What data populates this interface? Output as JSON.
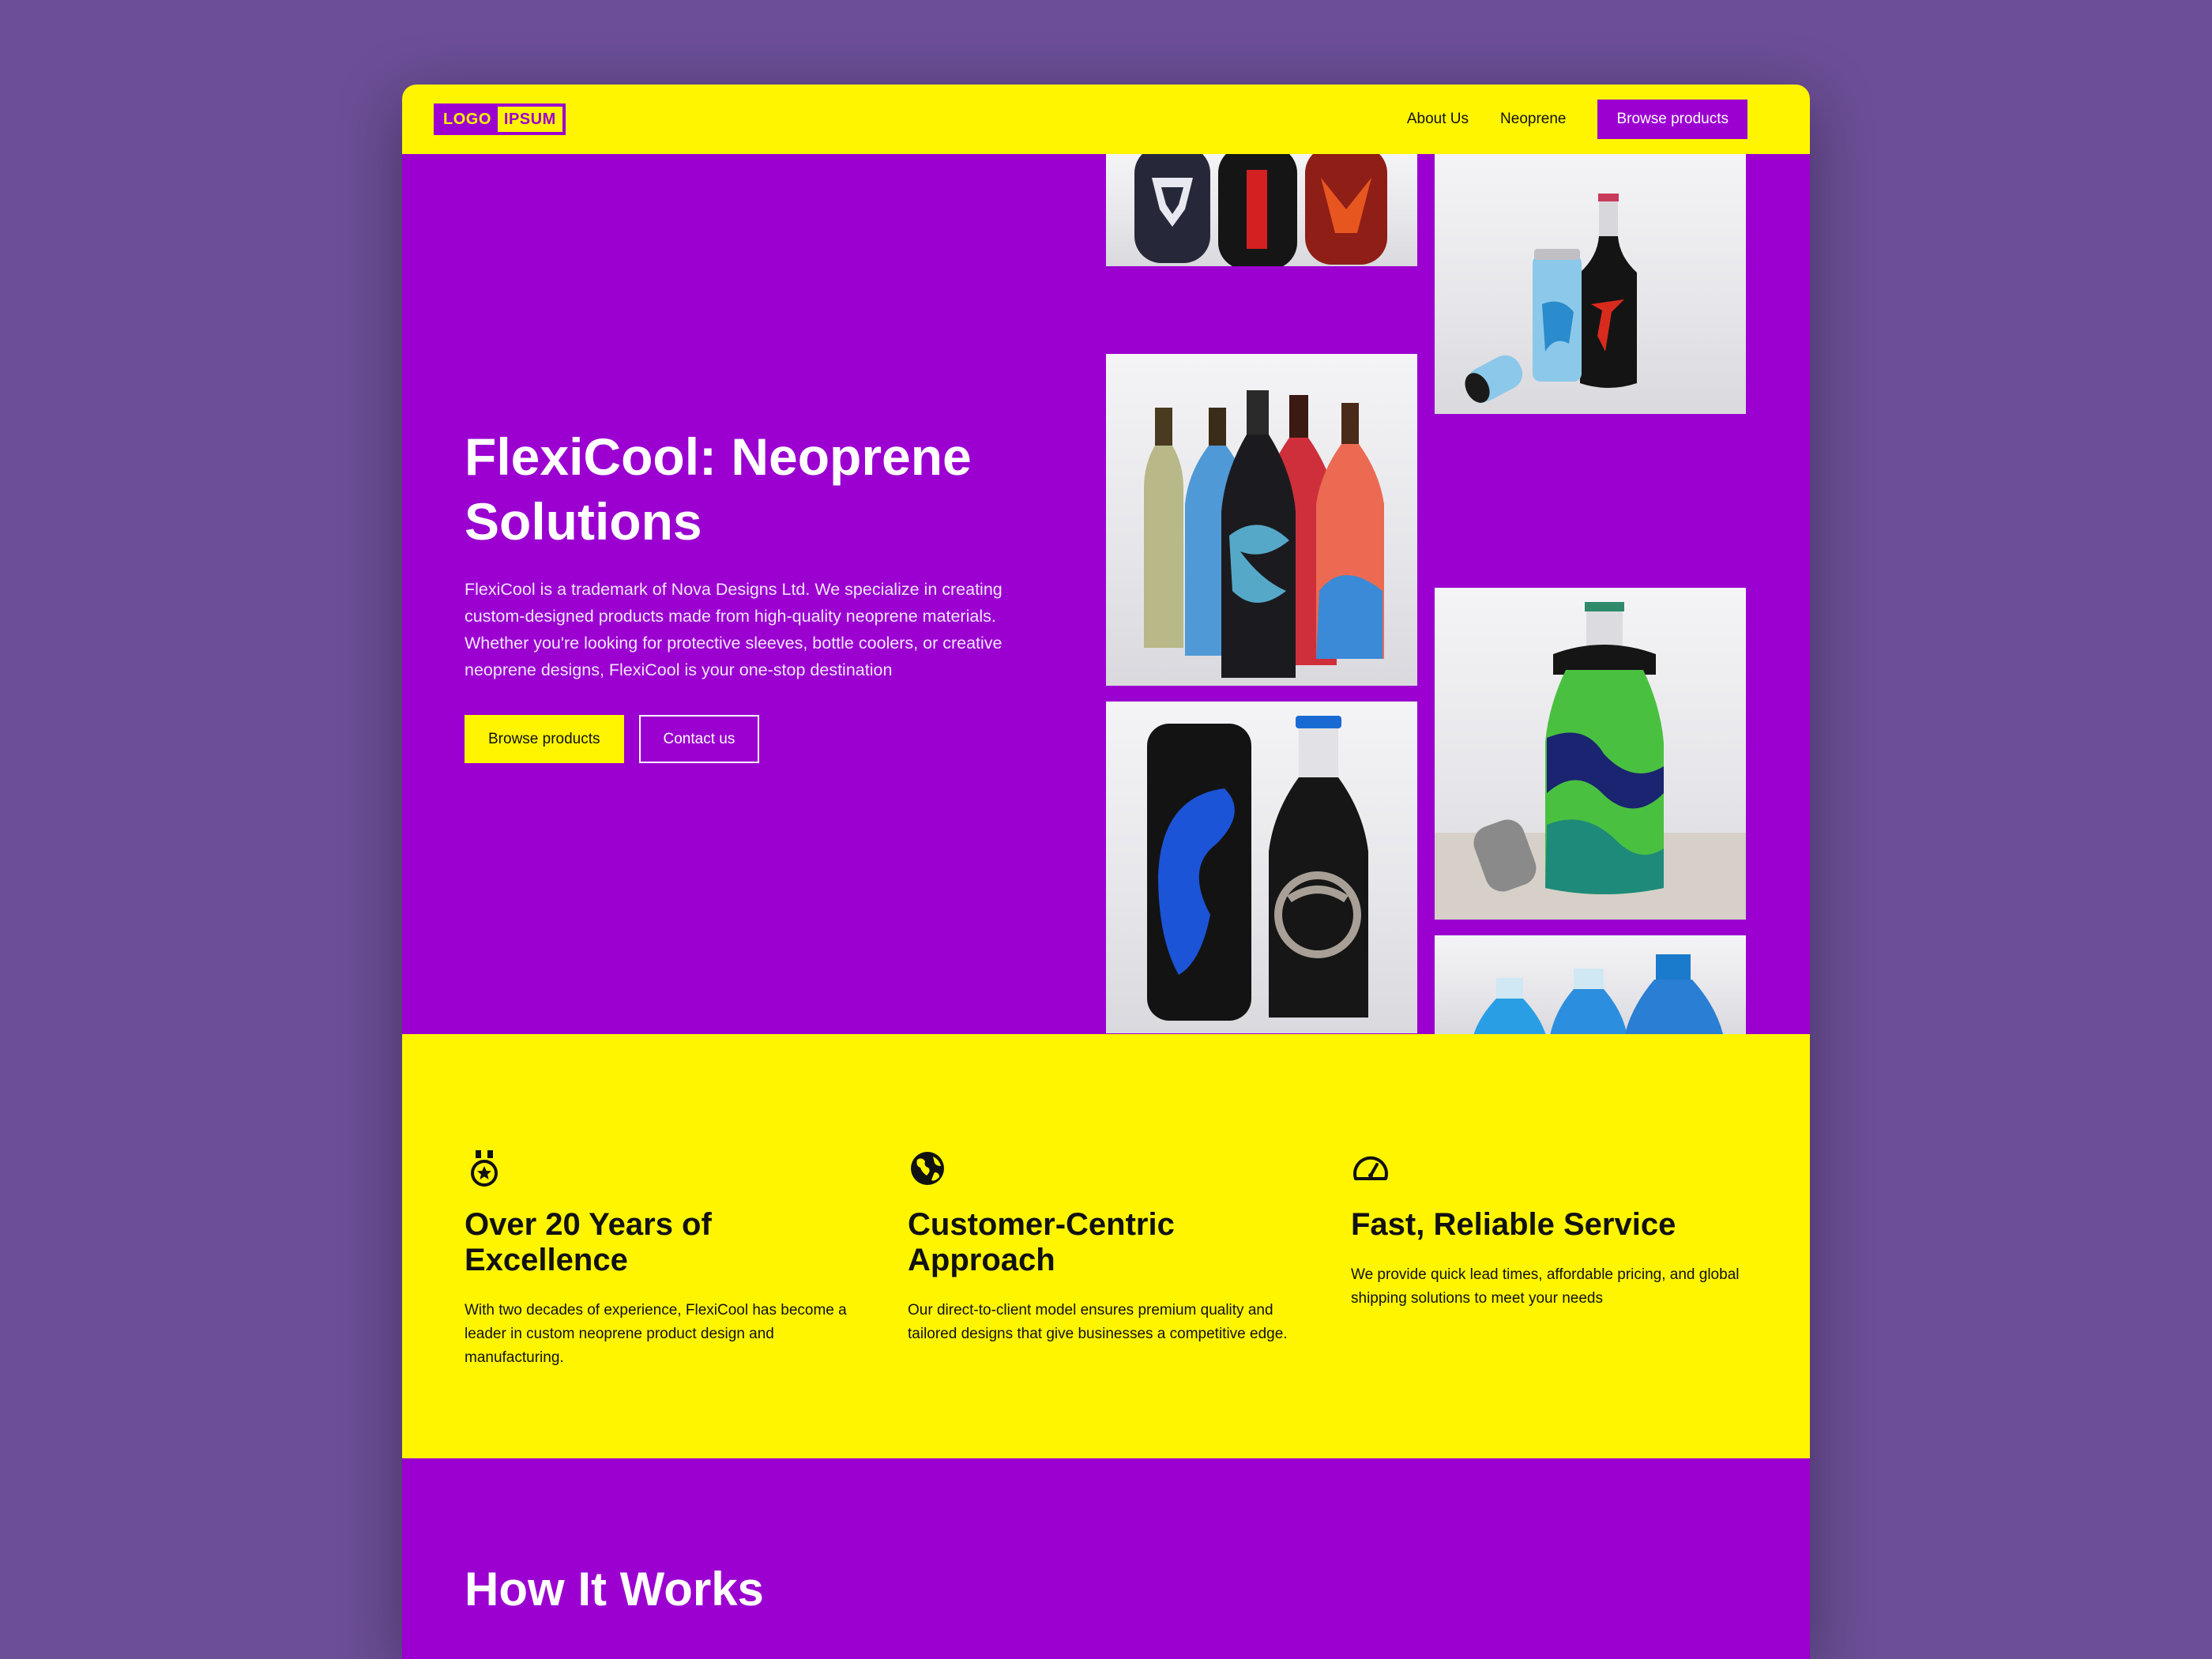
{
  "header": {
    "logo_left": "LOGO",
    "logo_right": "IPSUM",
    "nav": [
      {
        "label": "About Us"
      },
      {
        "label": "Neoprene"
      }
    ],
    "cta_label": "Browse products"
  },
  "hero": {
    "title": "FlexiCool: Neoprene Solutions",
    "description": "FlexiCool is a trademark of Nova Designs Ltd. We specialize in creating custom-designed products made from high-quality neoprene materials. Whether you're looking for protective sleeves, bottle coolers, or creative neoprene designs, FlexiCool is your one-stop destination",
    "primary_button": "Browse products",
    "secondary_button": "Contact us"
  },
  "features": [
    {
      "icon": "medal-icon",
      "title": "Over 20 Years of Excellence",
      "text": "With two decades of experience, FlexiCool has become a leader in custom neoprene product design and manufacturing."
    },
    {
      "icon": "globe-icon",
      "title": "Customer-Centric Approach",
      "text": "Our direct-to-client model ensures premium quality and tailored designs that give businesses a competitive edge."
    },
    {
      "icon": "speedometer-icon",
      "title": "Fast, Reliable Service",
      "text": "We provide quick lead times, affordable pricing, and global shipping solutions to meet your needs"
    }
  ],
  "how_it_works": {
    "title": "How It Works"
  },
  "colors": {
    "brand_purple": "#9b00d0",
    "brand_yellow": "#fff500",
    "page_background": "#6b4e96"
  }
}
